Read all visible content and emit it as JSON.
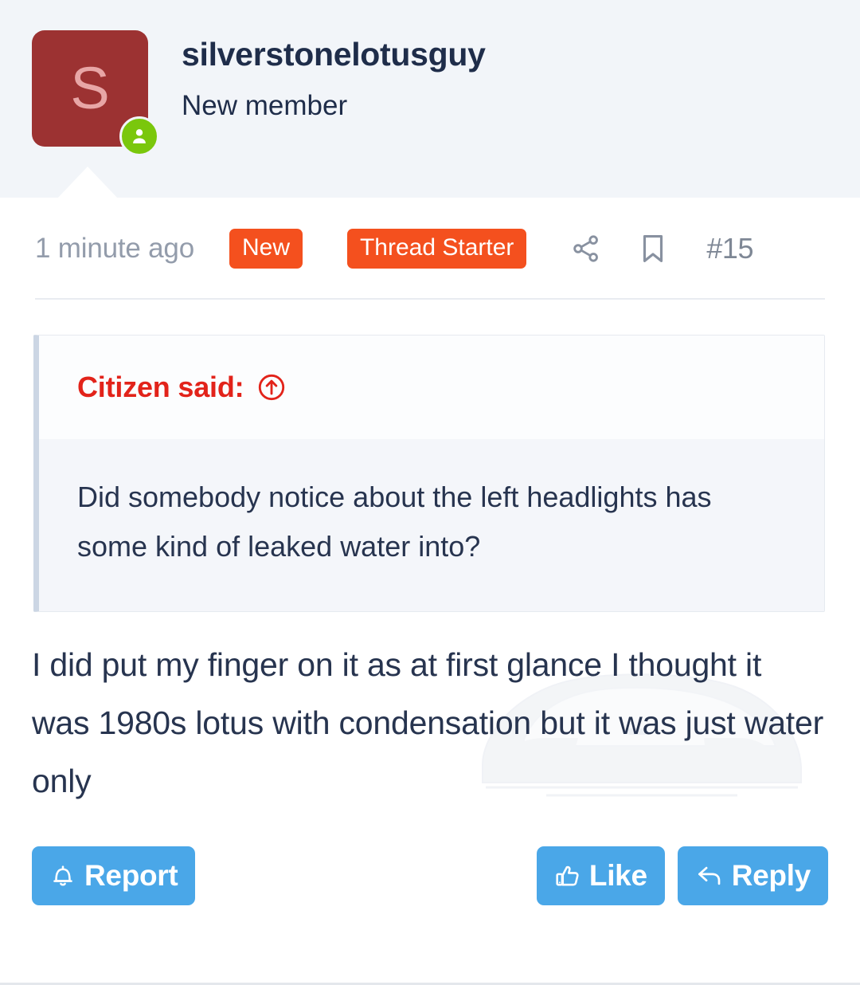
{
  "header": {
    "avatar_letter": "S",
    "username": "silverstonelotusguy",
    "user_title": "New member",
    "online_status_icon": "user-online-icon",
    "avatar_color": "#9c3232",
    "online_color": "#7ac70c"
  },
  "meta": {
    "timestamp": "1 minute ago",
    "badges": [
      {
        "label": "New",
        "color": "#f4501e"
      },
      {
        "label": "Thread Starter",
        "color": "#f4501e"
      }
    ],
    "share_icon": "share-icon",
    "bookmark_icon": "bookmark-icon",
    "post_number": "#15"
  },
  "quote": {
    "author_label": "Citizen said:",
    "jump_icon": "circle-arrow-up-icon",
    "accent_color": "#e2231a",
    "text": "Did somebody notice about the left headlights has some kind of leaked water into?"
  },
  "post": {
    "text": "I did put my finger on it as at first glance I thought it was 1980s lotus with condensation but it was just water only",
    "watermark": "sports-car-watermark"
  },
  "actions": {
    "report": {
      "label": "Report",
      "icon": "bell-icon"
    },
    "like": {
      "label": "Like",
      "icon": "thumbs-up-icon"
    },
    "reply": {
      "label": "Reply",
      "icon": "reply-arrow-icon"
    },
    "button_color": "#4aa7e8"
  }
}
